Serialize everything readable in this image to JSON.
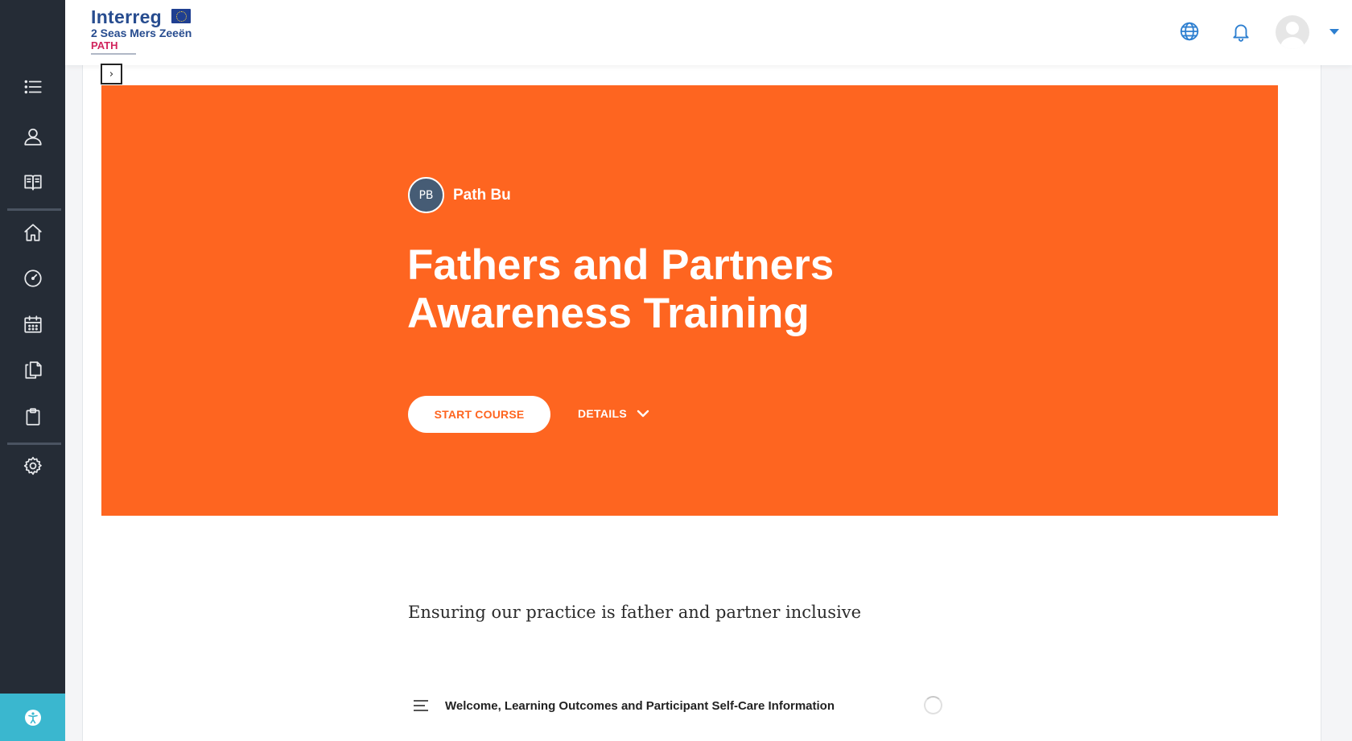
{
  "sidebar": {
    "items": [
      {
        "icon": "list-icon"
      },
      {
        "icon": "participants-icon"
      },
      {
        "icon": "book-icon"
      },
      {
        "icon": "home-icon"
      },
      {
        "icon": "dashboard-icon"
      },
      {
        "icon": "calendar-icon"
      },
      {
        "icon": "files-icon"
      },
      {
        "icon": "clipboard-icon"
      },
      {
        "icon": "gear-icon"
      }
    ],
    "accessibility_icon": "accessibility-icon"
  },
  "header": {
    "logo": {
      "line1": "Interreg",
      "line2": "2 Seas Mers Zeeën",
      "line3": "PATH"
    },
    "icons": [
      "globe-icon",
      "bell-icon"
    ],
    "accent_color": "#2d7fd0"
  },
  "hero": {
    "background_color": "#fe6520",
    "author_initials": "PB",
    "author_name": "Path Bu",
    "title": "Fathers and Partners Awareness Training",
    "start_label": "START COURSE",
    "details_label": "DETAILS"
  },
  "course": {
    "summary": "Ensuring our practice is father and partner inclusive",
    "sections": [
      {
        "title": "Welcome, Learning Outcomes and Participant Self-Care Information"
      }
    ]
  }
}
